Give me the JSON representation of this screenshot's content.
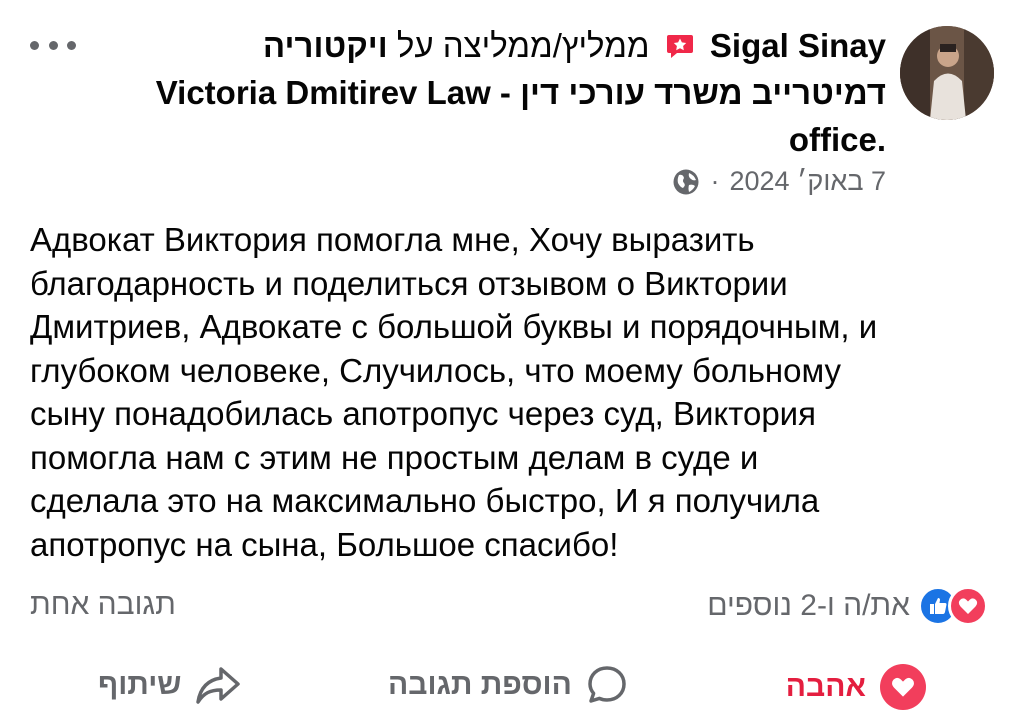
{
  "post": {
    "author": "Sigal Sinay",
    "recommends_text": "ממליץ/ממליצה על",
    "page_name": "ויקטוריה דמיטרייב משרד עורכי דין - Victoria Dmitirev Law office",
    "page_name_line1": "ויקטוריה",
    "page_name_line2": "דמיטרייב משרד עורכי דין - Victoria Dmitirev Law",
    "page_name_line3": ".office",
    "date": "7 באוק׳ 2024",
    "date_separator": "·",
    "privacy_icon": "globe-icon",
    "text": "Адвокат Виктория помогла мне, Хочу выразить\nблагодарность и поделиться отзывом о Виктории\nДмитриев, Адвокате с большой буквы и порядочным, и\nглубоком человеке, Случилось, что моему больному\nсыну понадобилась апотропус через суд, Виктория\nпомогла нам с этим не простым делам в суде и\nсделала это на максимально быстро, И я получила\nапотропус на сына, Большое спасибо!"
  },
  "reactions": {
    "summary": "את/ה ו-2 נוספים",
    "icons": [
      "love-icon",
      "like-icon"
    ]
  },
  "comments": {
    "count_label": "תגובה אחת"
  },
  "actions": {
    "love_label": "אהבה",
    "comment_label": "הוספת תגובה",
    "share_label": "שיתוף"
  },
  "colors": {
    "love": "#f23e5c",
    "like": "#1b74e4",
    "secondary_text": "#65676b",
    "recommend_badge": "#f02849"
  }
}
